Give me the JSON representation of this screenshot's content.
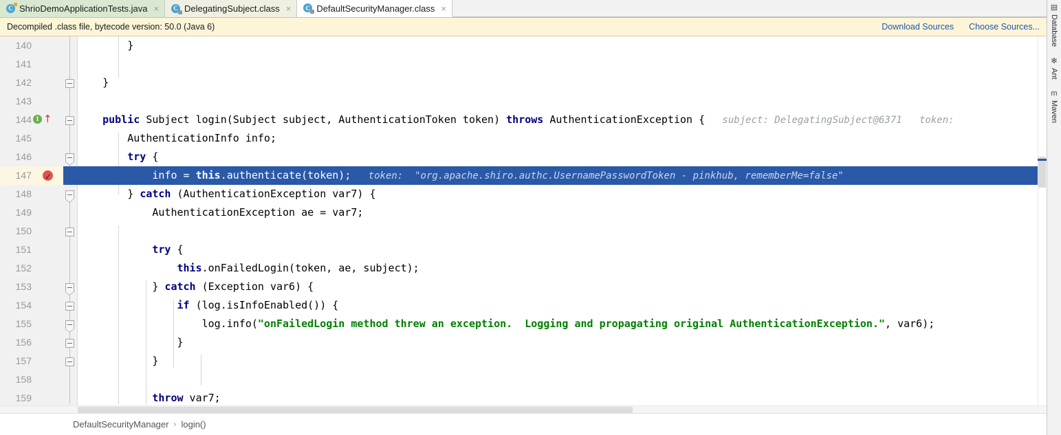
{
  "tabs": [
    {
      "label": "ShrioDemoApplicationTests.java",
      "icon": "java-test-class-icon",
      "state": "test",
      "close": "×"
    },
    {
      "label": "DelegatingSubject.class",
      "icon": "decompiled-class-icon",
      "state": "inactive",
      "close": "×"
    },
    {
      "label": "DefaultSecurityManager.class",
      "icon": "decompiled-class-icon",
      "state": "active",
      "close": "×"
    }
  ],
  "notification": {
    "message": "Decompiled .class file, bytecode version: 50.0 (Java 6)",
    "download_sources": "Download Sources",
    "choose_sources": "Choose Sources..."
  },
  "editor": {
    "class_letter": "C",
    "impl_marker": "I",
    "override_arrow": "↑",
    "lines": [
      {
        "num": "140",
        "segments": [
          {
            "t": "        }",
            "c": "plain"
          }
        ]
      },
      {
        "num": "141",
        "segments": [
          {
            "t": "",
            "c": "plain"
          }
        ]
      },
      {
        "num": "142",
        "segments": [
          {
            "t": "    }",
            "c": "plain"
          }
        ]
      },
      {
        "num": "143",
        "segments": [
          {
            "t": "",
            "c": "plain"
          }
        ]
      },
      {
        "num": "144",
        "segments": [
          {
            "t": "    ",
            "c": "plain"
          },
          {
            "t": "public",
            "c": "kw"
          },
          {
            "t": " Subject login(Subject subject, AuthenticationToken token) ",
            "c": "plain"
          },
          {
            "t": "throws",
            "c": "kw"
          },
          {
            "t": " AuthenticationException {",
            "c": "plain"
          },
          {
            "t": "   subject: DelegatingSubject@6371   token:",
            "c": "hint"
          }
        ]
      },
      {
        "num": "145",
        "segments": [
          {
            "t": "        AuthenticationInfo info;",
            "c": "plain"
          }
        ]
      },
      {
        "num": "146",
        "segments": [
          {
            "t": "        ",
            "c": "plain"
          },
          {
            "t": "try",
            "c": "kw"
          },
          {
            "t": " {",
            "c": "plain"
          }
        ]
      },
      {
        "num": "147",
        "segments": [
          {
            "t": "            info = ",
            "c": "plain"
          },
          {
            "t": "this",
            "c": "kw"
          },
          {
            "t": ".authenticate(token);",
            "c": "plain"
          },
          {
            "t": "   token:  \"org.apache.shiro.authc.UsernamePasswordToken - pinkhub, rememberMe=false\"",
            "c": "hint"
          }
        ]
      },
      {
        "num": "148",
        "segments": [
          {
            "t": "        } ",
            "c": "plain"
          },
          {
            "t": "catch",
            "c": "kw"
          },
          {
            "t": " (AuthenticationException var7) {",
            "c": "plain"
          }
        ]
      },
      {
        "num": "149",
        "segments": [
          {
            "t": "            AuthenticationException ae = var7;",
            "c": "plain"
          }
        ]
      },
      {
        "num": "150",
        "segments": [
          {
            "t": "",
            "c": "plain"
          }
        ]
      },
      {
        "num": "151",
        "segments": [
          {
            "t": "            ",
            "c": "plain"
          },
          {
            "t": "try",
            "c": "kw"
          },
          {
            "t": " {",
            "c": "plain"
          }
        ]
      },
      {
        "num": "152",
        "segments": [
          {
            "t": "                ",
            "c": "plain"
          },
          {
            "t": "this",
            "c": "kw"
          },
          {
            "t": ".onFailedLogin(token, ae, subject);",
            "c": "plain"
          }
        ]
      },
      {
        "num": "153",
        "segments": [
          {
            "t": "            } ",
            "c": "plain"
          },
          {
            "t": "catch",
            "c": "kw"
          },
          {
            "t": " (Exception var6) {",
            "c": "plain"
          }
        ]
      },
      {
        "num": "154",
        "segments": [
          {
            "t": "                ",
            "c": "plain"
          },
          {
            "t": "if",
            "c": "kw"
          },
          {
            "t": " (log.isInfoEnabled()) {",
            "c": "plain"
          }
        ]
      },
      {
        "num": "155",
        "segments": [
          {
            "t": "                    log.info(",
            "c": "plain"
          },
          {
            "t": "\"onFailedLogin method threw an exception.  Logging and propagating original AuthenticationException.\"",
            "c": "str"
          },
          {
            "t": ", var6);",
            "c": "plain"
          }
        ]
      },
      {
        "num": "156",
        "segments": [
          {
            "t": "                }",
            "c": "plain"
          }
        ]
      },
      {
        "num": "157",
        "segments": [
          {
            "t": "            }",
            "c": "plain"
          }
        ]
      },
      {
        "num": "158",
        "segments": [
          {
            "t": "",
            "c": "plain"
          }
        ]
      },
      {
        "num": "159",
        "segments": [
          {
            "t": "            ",
            "c": "plain"
          },
          {
            "t": "throw",
            "c": "kw"
          },
          {
            "t": " var7;",
            "c": "plain"
          }
        ]
      }
    ]
  },
  "breadcrumb": {
    "parts": [
      "DefaultSecurityManager",
      "login()"
    ],
    "separator": "›"
  },
  "right_toolbar": [
    {
      "label": "Database",
      "icon": "database-icon",
      "glyph": "▤"
    },
    {
      "label": "Ant",
      "icon": "ant-icon",
      "glyph": "✻"
    },
    {
      "label": "Maven",
      "icon": "maven-icon",
      "glyph": "m"
    }
  ],
  "colors": {
    "selection": "#2a59a8",
    "notification_bg": "#fcf5d8",
    "link": "#2557a7",
    "keyword": "#000080",
    "string": "#008000",
    "hint": "#9aa0a6"
  }
}
